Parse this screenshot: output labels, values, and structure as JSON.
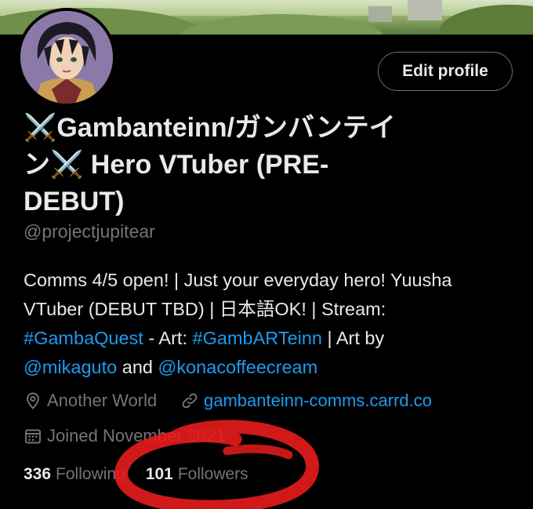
{
  "profile": {
    "display_name_line1": "⚔️Gambanteinn/ガンバンテイ",
    "display_name_line2": "ン⚔️ Hero VTuber (PRE-",
    "display_name_line3": "DEBUT)",
    "handle": "@projectjupitear",
    "edit_label": "Edit profile",
    "bio": {
      "line1": "Comms 4/5 open! | Just your everyday hero! Yuusha",
      "line2": "VTuber (DEBUT TBD) | 日本語OK! | Stream:",
      "hashtag1": "#GambaQuest",
      "art_text": " - Art: ",
      "hashtag2": "#GambARTeinn",
      "art_by": " | Art by",
      "mention1": "@mikaguto",
      "and_text": " and ",
      "mention2": "@konacoffeecream"
    },
    "location": "Another World",
    "website": "gambanteinn-comms.carrd.co",
    "joined": "Joined November 2021",
    "following_count": "336",
    "following_label": "Following",
    "followers_count": "101",
    "followers_label": "Followers"
  },
  "icons": {
    "location": "location-pin-icon",
    "website": "link-icon",
    "joined": "calendar-icon"
  },
  "colors": {
    "background": "#000000",
    "text": "#e7e9ea",
    "secondary": "#71767b",
    "accent": "#1d9bf0",
    "annotation": "#e81c1c"
  }
}
